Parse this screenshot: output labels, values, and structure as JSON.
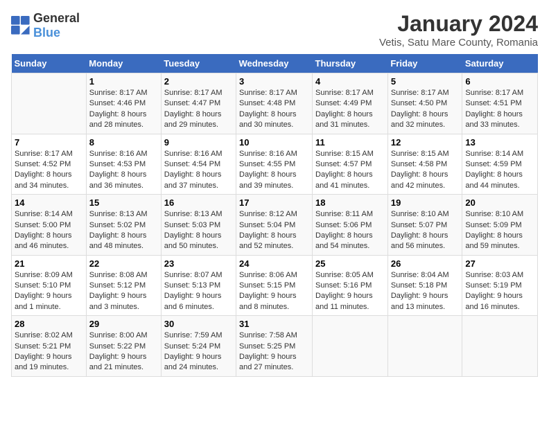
{
  "logo": {
    "general": "General",
    "blue": "Blue"
  },
  "title": "January 2024",
  "subtitle": "Vetis, Satu Mare County, Romania",
  "weekdays": [
    "Sunday",
    "Monday",
    "Tuesday",
    "Wednesday",
    "Thursday",
    "Friday",
    "Saturday"
  ],
  "weeks": [
    [
      {
        "day": "",
        "sunrise": "",
        "sunset": "",
        "daylight": ""
      },
      {
        "day": "1",
        "sunrise": "Sunrise: 8:17 AM",
        "sunset": "Sunset: 4:46 PM",
        "daylight": "Daylight: 8 hours and 28 minutes."
      },
      {
        "day": "2",
        "sunrise": "Sunrise: 8:17 AM",
        "sunset": "Sunset: 4:47 PM",
        "daylight": "Daylight: 8 hours and 29 minutes."
      },
      {
        "day": "3",
        "sunrise": "Sunrise: 8:17 AM",
        "sunset": "Sunset: 4:48 PM",
        "daylight": "Daylight: 8 hours and 30 minutes."
      },
      {
        "day": "4",
        "sunrise": "Sunrise: 8:17 AM",
        "sunset": "Sunset: 4:49 PM",
        "daylight": "Daylight: 8 hours and 31 minutes."
      },
      {
        "day": "5",
        "sunrise": "Sunrise: 8:17 AM",
        "sunset": "Sunset: 4:50 PM",
        "daylight": "Daylight: 8 hours and 32 minutes."
      },
      {
        "day": "6",
        "sunrise": "Sunrise: 8:17 AM",
        "sunset": "Sunset: 4:51 PM",
        "daylight": "Daylight: 8 hours and 33 minutes."
      }
    ],
    [
      {
        "day": "7",
        "sunrise": "Sunrise: 8:17 AM",
        "sunset": "Sunset: 4:52 PM",
        "daylight": "Daylight: 8 hours and 34 minutes."
      },
      {
        "day": "8",
        "sunrise": "Sunrise: 8:16 AM",
        "sunset": "Sunset: 4:53 PM",
        "daylight": "Daylight: 8 hours and 36 minutes."
      },
      {
        "day": "9",
        "sunrise": "Sunrise: 8:16 AM",
        "sunset": "Sunset: 4:54 PM",
        "daylight": "Daylight: 8 hours and 37 minutes."
      },
      {
        "day": "10",
        "sunrise": "Sunrise: 8:16 AM",
        "sunset": "Sunset: 4:55 PM",
        "daylight": "Daylight: 8 hours and 39 minutes."
      },
      {
        "day": "11",
        "sunrise": "Sunrise: 8:15 AM",
        "sunset": "Sunset: 4:57 PM",
        "daylight": "Daylight: 8 hours and 41 minutes."
      },
      {
        "day": "12",
        "sunrise": "Sunrise: 8:15 AM",
        "sunset": "Sunset: 4:58 PM",
        "daylight": "Daylight: 8 hours and 42 minutes."
      },
      {
        "day": "13",
        "sunrise": "Sunrise: 8:14 AM",
        "sunset": "Sunset: 4:59 PM",
        "daylight": "Daylight: 8 hours and 44 minutes."
      }
    ],
    [
      {
        "day": "14",
        "sunrise": "Sunrise: 8:14 AM",
        "sunset": "Sunset: 5:00 PM",
        "daylight": "Daylight: 8 hours and 46 minutes."
      },
      {
        "day": "15",
        "sunrise": "Sunrise: 8:13 AM",
        "sunset": "Sunset: 5:02 PM",
        "daylight": "Daylight: 8 hours and 48 minutes."
      },
      {
        "day": "16",
        "sunrise": "Sunrise: 8:13 AM",
        "sunset": "Sunset: 5:03 PM",
        "daylight": "Daylight: 8 hours and 50 minutes."
      },
      {
        "day": "17",
        "sunrise": "Sunrise: 8:12 AM",
        "sunset": "Sunset: 5:04 PM",
        "daylight": "Daylight: 8 hours and 52 minutes."
      },
      {
        "day": "18",
        "sunrise": "Sunrise: 8:11 AM",
        "sunset": "Sunset: 5:06 PM",
        "daylight": "Daylight: 8 hours and 54 minutes."
      },
      {
        "day": "19",
        "sunrise": "Sunrise: 8:10 AM",
        "sunset": "Sunset: 5:07 PM",
        "daylight": "Daylight: 8 hours and 56 minutes."
      },
      {
        "day": "20",
        "sunrise": "Sunrise: 8:10 AM",
        "sunset": "Sunset: 5:09 PM",
        "daylight": "Daylight: 8 hours and 59 minutes."
      }
    ],
    [
      {
        "day": "21",
        "sunrise": "Sunrise: 8:09 AM",
        "sunset": "Sunset: 5:10 PM",
        "daylight": "Daylight: 9 hours and 1 minute."
      },
      {
        "day": "22",
        "sunrise": "Sunrise: 8:08 AM",
        "sunset": "Sunset: 5:12 PM",
        "daylight": "Daylight: 9 hours and 3 minutes."
      },
      {
        "day": "23",
        "sunrise": "Sunrise: 8:07 AM",
        "sunset": "Sunset: 5:13 PM",
        "daylight": "Daylight: 9 hours and 6 minutes."
      },
      {
        "day": "24",
        "sunrise": "Sunrise: 8:06 AM",
        "sunset": "Sunset: 5:15 PM",
        "daylight": "Daylight: 9 hours and 8 minutes."
      },
      {
        "day": "25",
        "sunrise": "Sunrise: 8:05 AM",
        "sunset": "Sunset: 5:16 PM",
        "daylight": "Daylight: 9 hours and 11 minutes."
      },
      {
        "day": "26",
        "sunrise": "Sunrise: 8:04 AM",
        "sunset": "Sunset: 5:18 PM",
        "daylight": "Daylight: 9 hours and 13 minutes."
      },
      {
        "day": "27",
        "sunrise": "Sunrise: 8:03 AM",
        "sunset": "Sunset: 5:19 PM",
        "daylight": "Daylight: 9 hours and 16 minutes."
      }
    ],
    [
      {
        "day": "28",
        "sunrise": "Sunrise: 8:02 AM",
        "sunset": "Sunset: 5:21 PM",
        "daylight": "Daylight: 9 hours and 19 minutes."
      },
      {
        "day": "29",
        "sunrise": "Sunrise: 8:00 AM",
        "sunset": "Sunset: 5:22 PM",
        "daylight": "Daylight: 9 hours and 21 minutes."
      },
      {
        "day": "30",
        "sunrise": "Sunrise: 7:59 AM",
        "sunset": "Sunset: 5:24 PM",
        "daylight": "Daylight: 9 hours and 24 minutes."
      },
      {
        "day": "31",
        "sunrise": "Sunrise: 7:58 AM",
        "sunset": "Sunset: 5:25 PM",
        "daylight": "Daylight: 9 hours and 27 minutes."
      },
      {
        "day": "",
        "sunrise": "",
        "sunset": "",
        "daylight": ""
      },
      {
        "day": "",
        "sunrise": "",
        "sunset": "",
        "daylight": ""
      },
      {
        "day": "",
        "sunrise": "",
        "sunset": "",
        "daylight": ""
      }
    ]
  ]
}
